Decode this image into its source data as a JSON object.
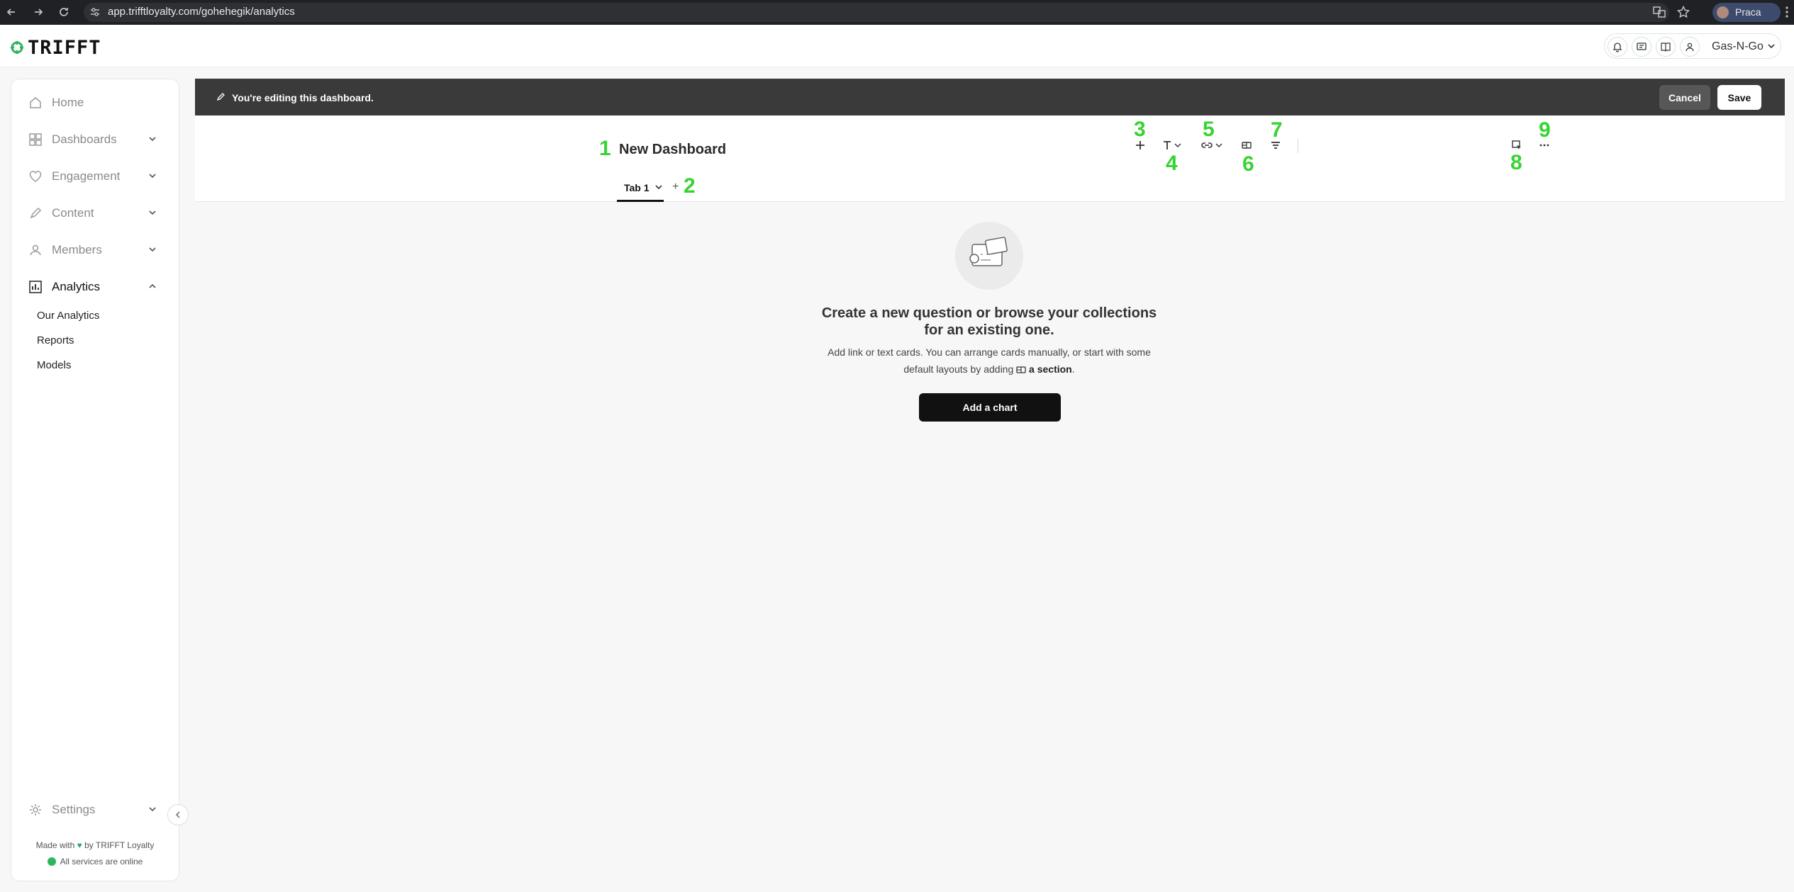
{
  "browser": {
    "url": "app.trifftloyalty.com/gohehegik/analytics",
    "profile_name": "Praca"
  },
  "app": {
    "logo_text": "TRIFFT",
    "org_name": "Gas-N-Go"
  },
  "sidebar": {
    "items": [
      {
        "label": "Home",
        "icon": "home-icon"
      },
      {
        "label": "Dashboards",
        "icon": "grid-icon"
      },
      {
        "label": "Engagement",
        "icon": "heart-icon"
      },
      {
        "label": "Content",
        "icon": "pen-icon"
      },
      {
        "label": "Members",
        "icon": "user-icon"
      },
      {
        "label": "Analytics",
        "icon": "bar-chart-icon"
      }
    ],
    "analytics_subitems": [
      "Our Analytics",
      "Reports",
      "Models"
    ],
    "settings_label": "Settings",
    "footer_made_with": "Made with",
    "footer_by": "by TRIFFT Loyalty",
    "footer_status": "All services are online"
  },
  "edit_bar": {
    "message": "You're editing this dashboard.",
    "cancel_label": "Cancel",
    "save_label": "Save"
  },
  "dashboard": {
    "title": "New Dashboard",
    "tabs": [
      {
        "label": "Tab 1"
      }
    ],
    "add_tab_label": "+"
  },
  "annotations": [
    "1",
    "2",
    "3",
    "4",
    "5",
    "6",
    "7",
    "8",
    "9"
  ],
  "empty_state": {
    "heading": "Create a new question or browse your collections for an existing one.",
    "text_before": "Add link or text cards. You can arrange cards manually, or start with some default layouts by adding",
    "section_label": "a section",
    "text_after": ".",
    "button_label": "Add a chart"
  },
  "colors": {
    "annotation": "#37d431",
    "edit_bar_bg": "#3a3a3a",
    "accent": "#2fb55d"
  }
}
